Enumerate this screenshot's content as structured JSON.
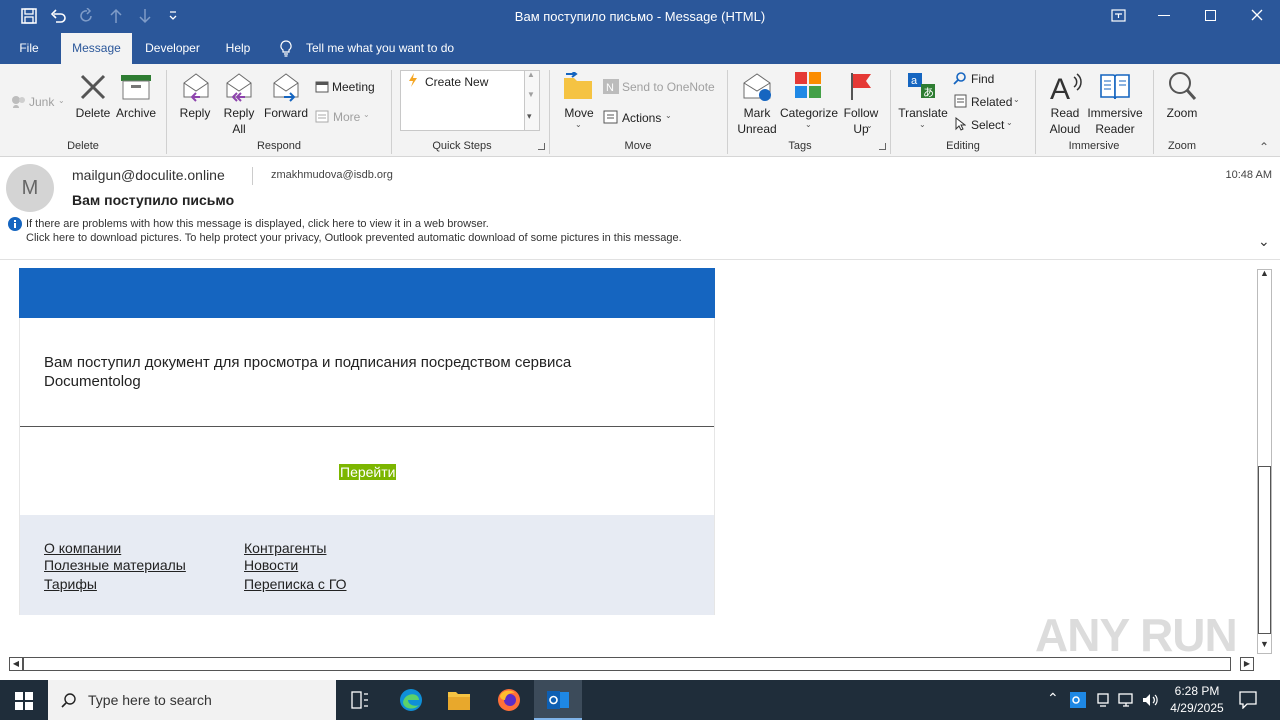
{
  "window": {
    "title": "Вам поступило письмо  -  Message (HTML)"
  },
  "tabs": [
    {
      "label": "File"
    },
    {
      "label": "Message"
    },
    {
      "label": "Developer"
    },
    {
      "label": "Help"
    }
  ],
  "tell_me": "Tell me what you want to do",
  "ribbon": {
    "delete_group": {
      "junk": "Junk",
      "delete": "Delete",
      "archive": "Archive",
      "label": "Delete"
    },
    "respond_group": {
      "reply": "Reply",
      "reply_all_1": "Reply",
      "reply_all_2": "All",
      "forward": "Forward",
      "meeting": "Meeting",
      "more": "More",
      "label": "Respond"
    },
    "quick_steps": {
      "create_new": "Create New",
      "label": "Quick Steps"
    },
    "move_group": {
      "move": "Move",
      "onenote": "Send to OneNote",
      "actions": "Actions",
      "label": "Move"
    },
    "tags_group": {
      "mark_unread_1": "Mark",
      "mark_unread_2": "Unread",
      "categorize": "Categorize",
      "follow_up_1": "Follow",
      "follow_up_2": "Up",
      "label": "Tags"
    },
    "editing_group": {
      "translate": "Translate",
      "find": "Find",
      "related": "Related",
      "select": "Select",
      "label": "Editing"
    },
    "immersive_group": {
      "read_aloud_1": "Read",
      "read_aloud_2": "Aloud",
      "immersive_reader_1": "Immersive",
      "immersive_reader_2": "Reader",
      "label": "Immersive"
    },
    "zoom_group": {
      "zoom": "Zoom",
      "label": "Zoom"
    }
  },
  "message": {
    "avatar_initial": "M",
    "from": "mailgun@doculite.online",
    "to": "zmakhmudova@isdb.org",
    "time": "10:48 AM",
    "subject": "Вам поступило письмо",
    "info_line_1": "If there are problems with how this message is displayed, click here to view it in a web browser.",
    "info_line_2": "Click here to download pictures. To help protect your privacy, Outlook prevented automatic download of some pictures in this message."
  },
  "email": {
    "body_text_1": "Вам поступил документ для просмотра и подписания посредством сервиса",
    "body_text_2": "Documentolog",
    "button": "Перейти",
    "footer_links_col1": [
      "О компании",
      "Полезные материалы",
      "Тарифы"
    ],
    "footer_links_col2": [
      "Контрагенты",
      "Новости",
      "Переписка с ГО"
    ],
    "header_color": "#1565c0",
    "button_color": "#7cb600"
  },
  "taskbar": {
    "search_placeholder": "Type here to search",
    "time": "6:28 PM",
    "date": "4/29/2025"
  },
  "watermark": "ANY RUN"
}
